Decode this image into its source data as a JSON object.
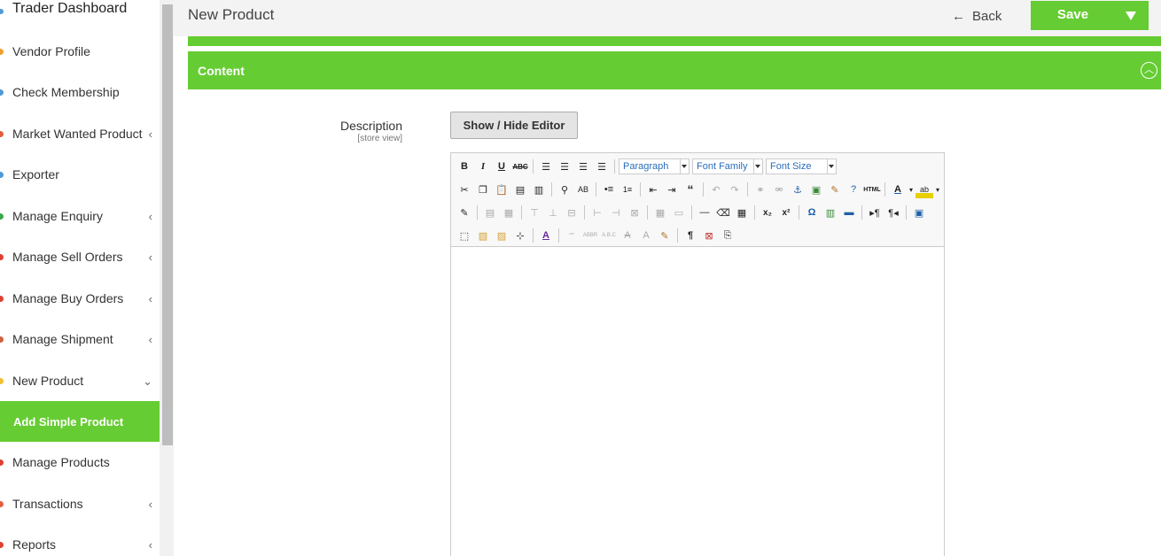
{
  "sidebar": {
    "title": "Trader Dashboard",
    "items": [
      {
        "label": "Vendor Profile",
        "chevron": "",
        "color": "#f0a030"
      },
      {
        "label": "Check Membership",
        "chevron": "",
        "color": "#4f9ad6"
      },
      {
        "label": "Market Wanted Product",
        "chevron": "‹",
        "color": "#e06040"
      },
      {
        "label": "Exporter",
        "chevron": "",
        "color": "#4f9ad6"
      },
      {
        "label": "Manage Enquiry",
        "chevron": "‹",
        "color": "#3aa84a"
      },
      {
        "label": "Manage Sell Orders",
        "chevron": "‹",
        "color": "#e04030"
      },
      {
        "label": "Manage Buy Orders",
        "chevron": "‹",
        "color": "#e04030"
      },
      {
        "label": "Manage Shipment",
        "chevron": "‹",
        "color": "#d06040"
      },
      {
        "label": "New Product",
        "chevron": "⌄",
        "color": "#f0c030"
      },
      {
        "label": "Add Simple Product",
        "chevron": "",
        "color": ""
      },
      {
        "label": "Manage Products",
        "chevron": "",
        "color": "#e04030"
      },
      {
        "label": "Transactions",
        "chevron": "‹",
        "color": "#e06040"
      },
      {
        "label": "Reports",
        "chevron": "‹",
        "color": "#e04030"
      }
    ]
  },
  "header": {
    "title": "New Product",
    "back_label": "Back",
    "save_label": "Save"
  },
  "section": {
    "title": "Content"
  },
  "form": {
    "description_label": "Description",
    "description_scope": "[store view]",
    "toggle_editor_label": "Show / Hide Editor"
  },
  "editor": {
    "format_select": "Paragraph",
    "font_family_select": "Font Family",
    "font_size_select": "Font Size"
  },
  "colors": {
    "accent": "#66cc33",
    "header_bg": "#f3f3f3"
  }
}
